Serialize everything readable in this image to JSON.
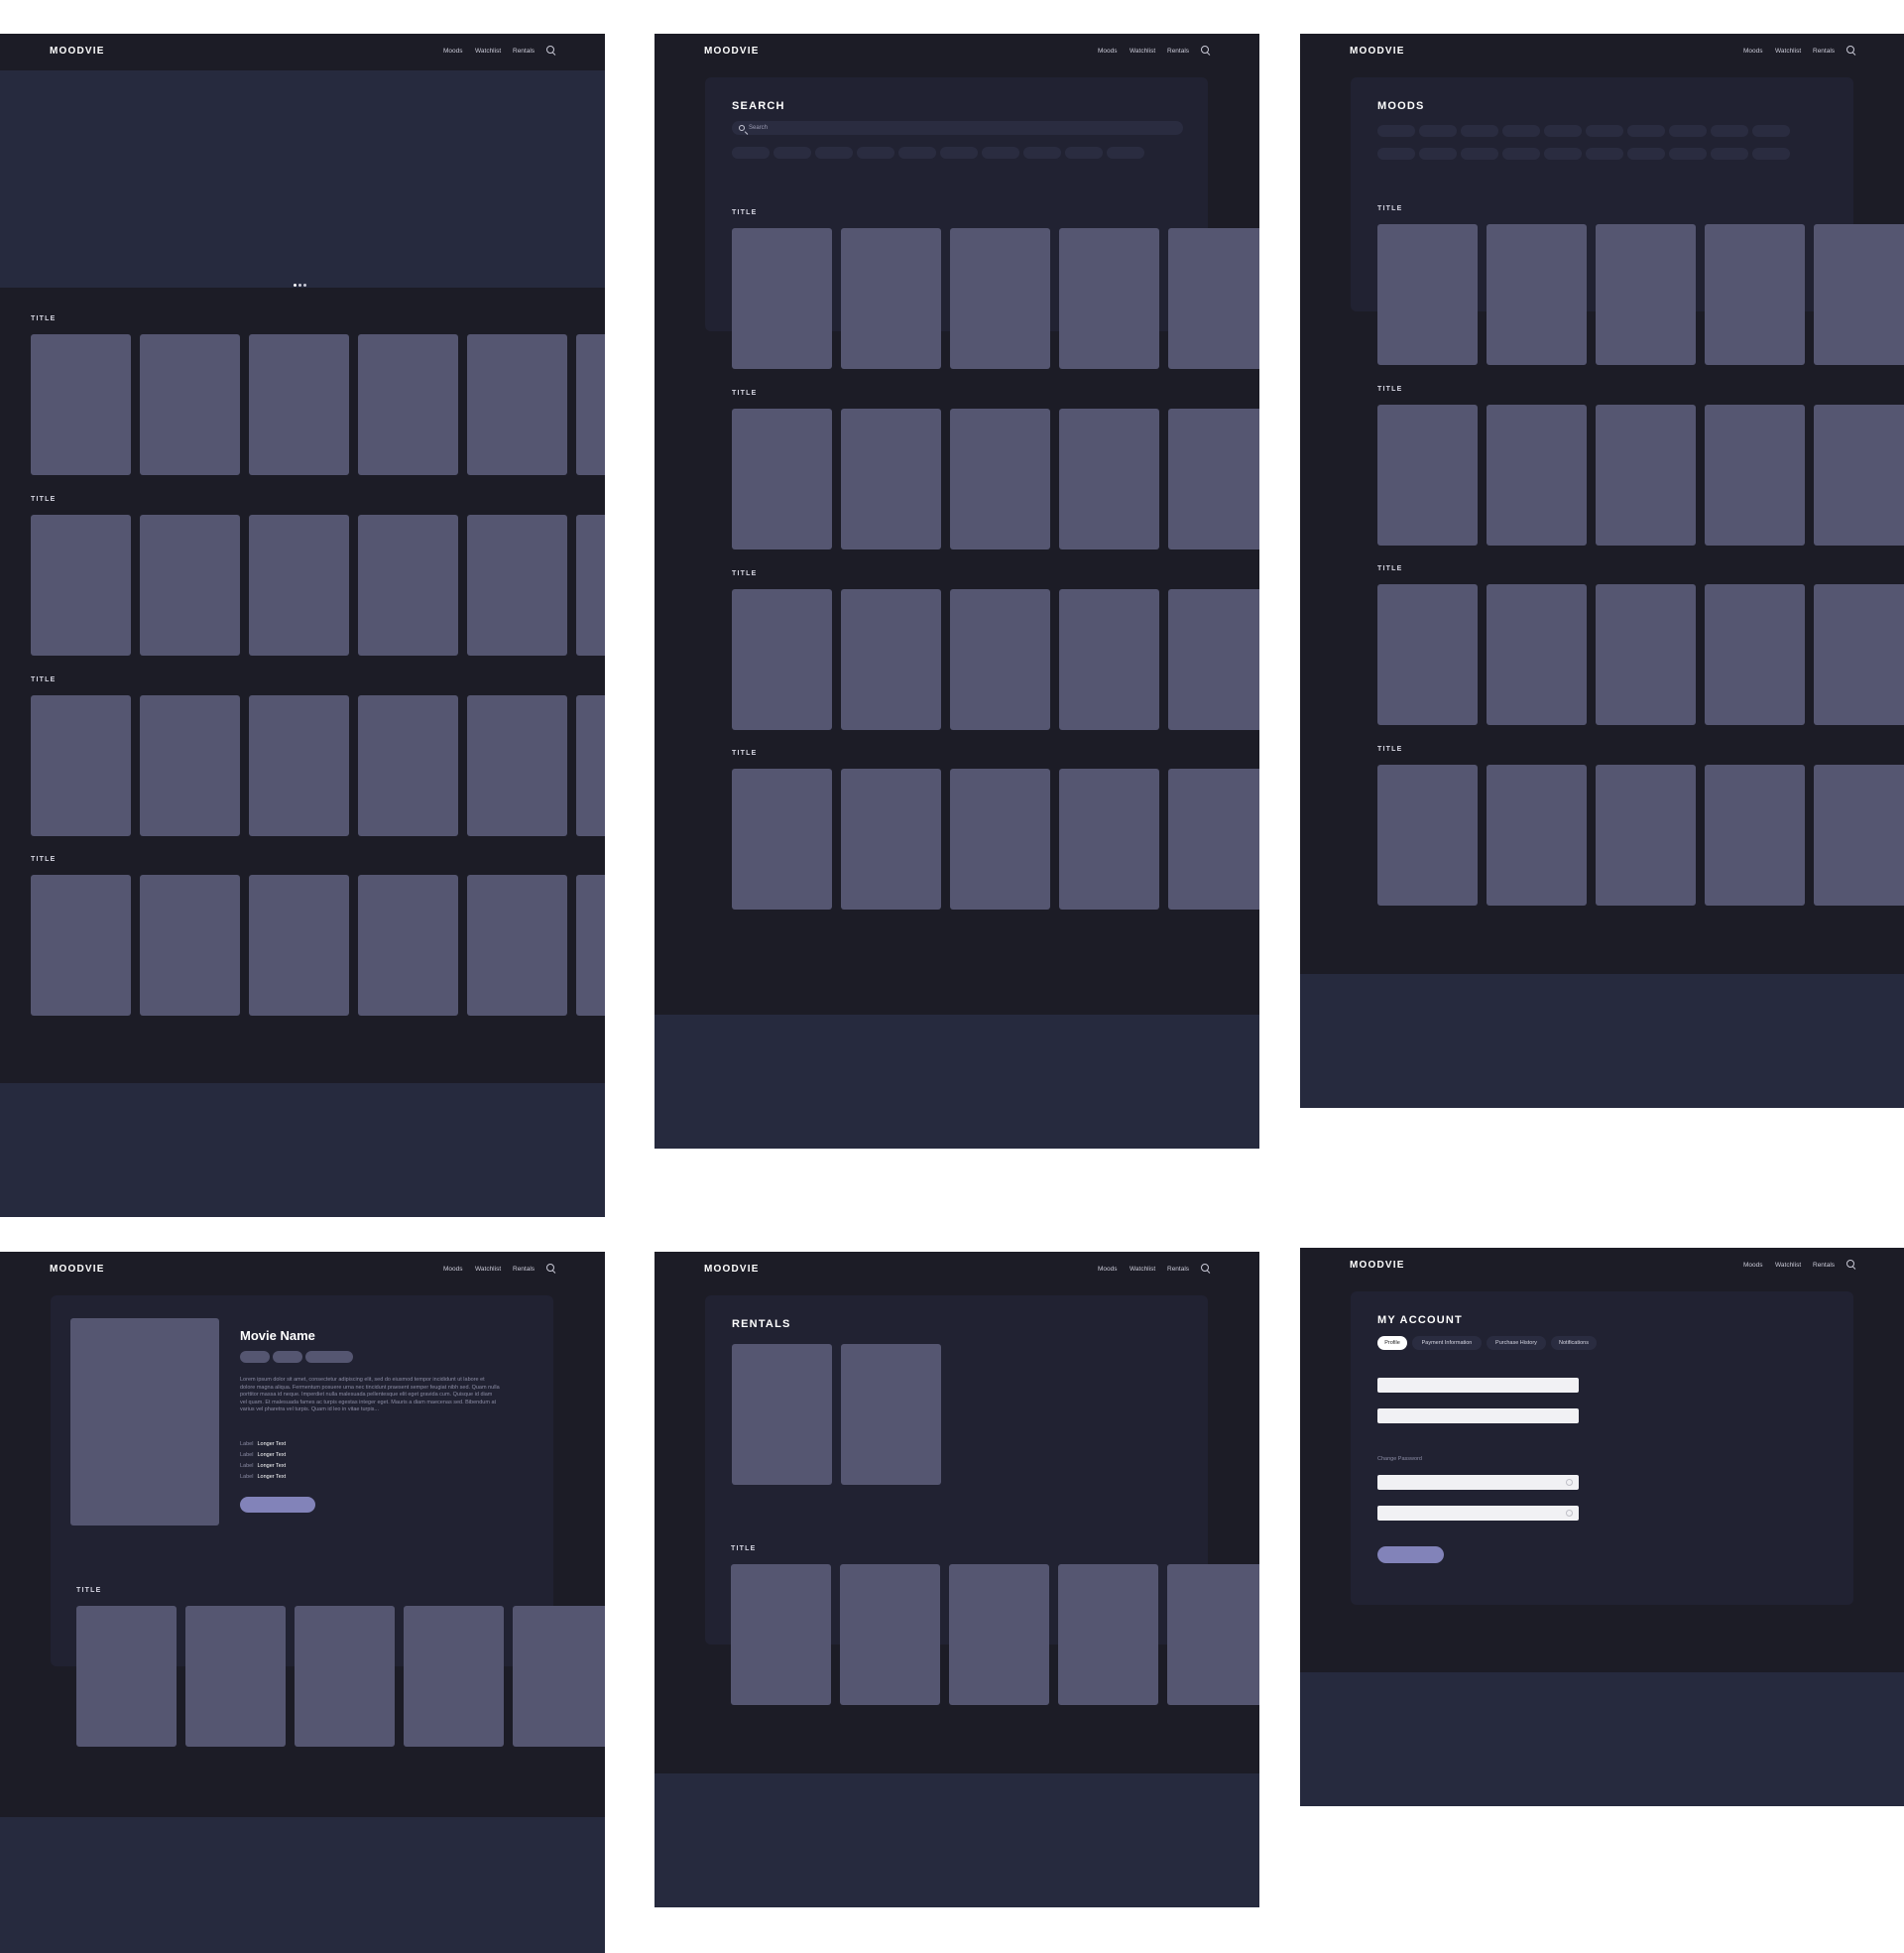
{
  "nav": {
    "logo": "MOODVIE",
    "moods": "Moods",
    "watchlist": "Watchlist",
    "rentals": "Rentals"
  },
  "row_title": "TITLE",
  "search": {
    "heading": "SEARCH",
    "placeholder": "Search"
  },
  "moods": {
    "heading": "MOODS"
  },
  "detail": {
    "movie_name": "Movie Name",
    "description": "Lorem ipsum dolor sit amet, consectetur adipiscing elit, sed do eiusmod tempor incididunt ut labore et dolore magna aliqua. Fermentum posuere urna nec tincidunt praesent semper feugiat nibh sed. Quam nulla porttitor massa id neque. Imperdiet nulla malesuada pellentesque elit eget gravida cum. Quisque id diam vel quam. Et malesuada fames ac turpis egestas integer eget. Mauris a diam maecenas sed. Bibendum at varius vel pharetra vel turpis. Quam id leo in vitae turpis...",
    "meta": [
      {
        "label": "Label",
        "value": "Longer Text"
      },
      {
        "label": "Label",
        "value": "Longer Text"
      },
      {
        "label": "Label",
        "value": "Longer Text"
      },
      {
        "label": "Label",
        "value": "Longer Text"
      }
    ]
  },
  "rentals": {
    "heading": "RENTALS"
  },
  "account": {
    "heading": "MY ACCOUNT",
    "tabs": [
      "Profile",
      "Payment Information",
      "Purchase History",
      "Notifications"
    ],
    "change_password": "Change Password"
  },
  "colors": {
    "bg": "#1c1c26",
    "panel": "#212232",
    "card": "#555671",
    "accent": "#8283b9",
    "footer": "#262a3e"
  }
}
